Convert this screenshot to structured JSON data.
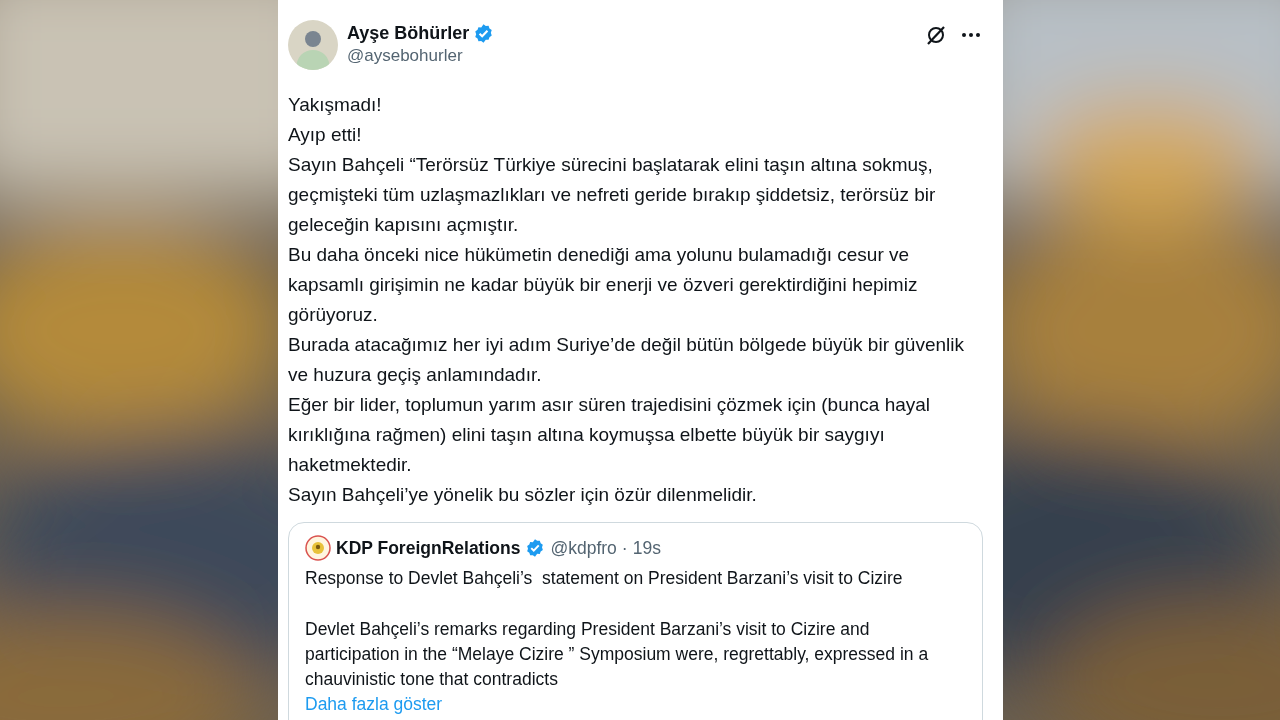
{
  "post": {
    "author": {
      "name": "Ayşe Böhürler",
      "handle": "@aysebohurler",
      "verified": true
    },
    "paragraphs": [
      "Yakışmadı!",
      "Ayıp etti!",
      "Sayın Bahçeli “Terörsüz Türkiye sürecini başlatarak elini taşın altına sokmuş, geçmişteki tüm uzlaşmazlıkları ve nefreti geride bırakıp şiddetsiz, terörsüz bir geleceğin kapısını açmıştır.",
      "Bu daha önceki nice hükümetin denediği ama yolunu bulamadığı cesur ve kapsamlı girişimin ne kadar büyük bir enerji ve özveri gerektirdiğini hepimiz görüyoruz.",
      "Burada atacağımız her iyi adım Suriye’de değil bütün bölgede büyük bir güvenlik ve huzura geçiş anlamındadır.",
      "Eğer bir lider, toplumun yarım asır süren trajedisini çözmek için (bunca hayal kırıklığına rağmen) elini taşın altına koymuşsa elbette büyük bir saygıyı haketmektedir.",
      "Sayın Bahçeli’ye yönelik bu sözler için özür dilenmelidir."
    ],
    "quote": {
      "author": {
        "name": "KDP ForeignRelations",
        "handle": "@kdpfro",
        "separator": "·",
        "time": "19s",
        "verified": true
      },
      "title": "Response to Devlet Bahçeli’s  statement on President Barzani’s visit to Cizire",
      "body": "Devlet Bahçeli’s remarks regarding President Barzani’s visit to Cizire and participation in the “Melaye Cizire ” Symposium were, regrettably, expressed in a chauvinistic tone that contradicts",
      "more_link": "Daha fazla göster"
    }
  }
}
